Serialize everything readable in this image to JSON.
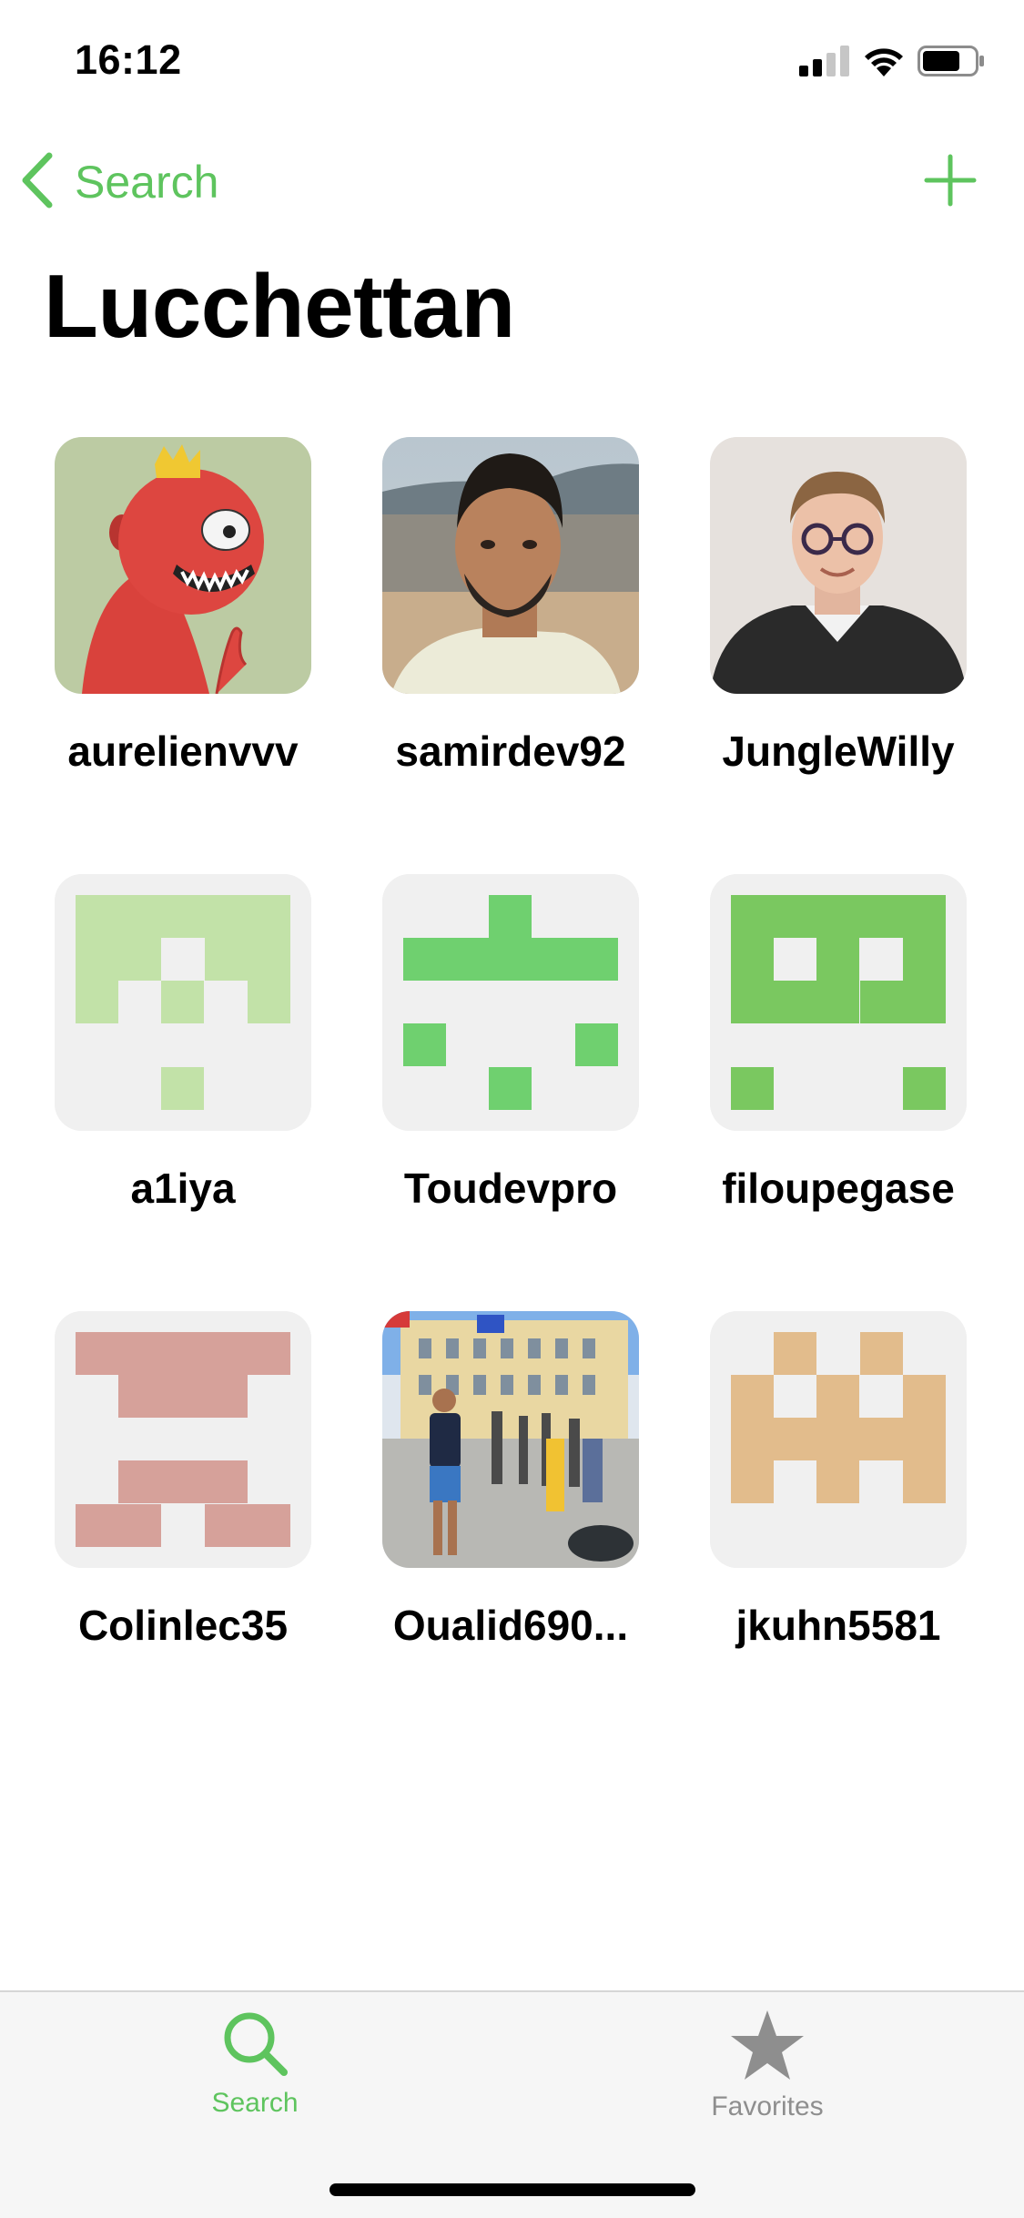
{
  "status_bar": {
    "time": "16:12"
  },
  "nav": {
    "back_label": "Search",
    "back_icon": "chevron-left-icon",
    "add_icon": "plus-icon"
  },
  "page": {
    "title": "Lucchettan"
  },
  "colors": {
    "accent": "#5ec45e",
    "inactive": "#8e8e8e"
  },
  "users": [
    {
      "name": "aurelienvvv",
      "avatar": "cartoon-monster-photo"
    },
    {
      "name": "samirdev92",
      "avatar": "portrait-photo"
    },
    {
      "name": "JungleWilly",
      "avatar": "portrait-photo"
    },
    {
      "name": "a1iya",
      "avatar": "identicon",
      "color": "#c2e2a8"
    },
    {
      "name": "Toudevpro",
      "avatar": "identicon",
      "color": "#6fd06f"
    },
    {
      "name": "filoupegase",
      "avatar": "identicon",
      "color": "#7ac860"
    },
    {
      "name": "Colinlec35",
      "avatar": "identicon",
      "color": "#d6a19a"
    },
    {
      "name": "Oualid690...",
      "avatar": "street-photo"
    },
    {
      "name": "jkuhn5581",
      "avatar": "identicon",
      "color": "#e2bc8c"
    }
  ],
  "tab_bar": {
    "tabs": [
      {
        "label": "Search",
        "icon": "search-icon",
        "active": true
      },
      {
        "label": "Favorites",
        "icon": "star-icon",
        "active": false
      }
    ]
  }
}
